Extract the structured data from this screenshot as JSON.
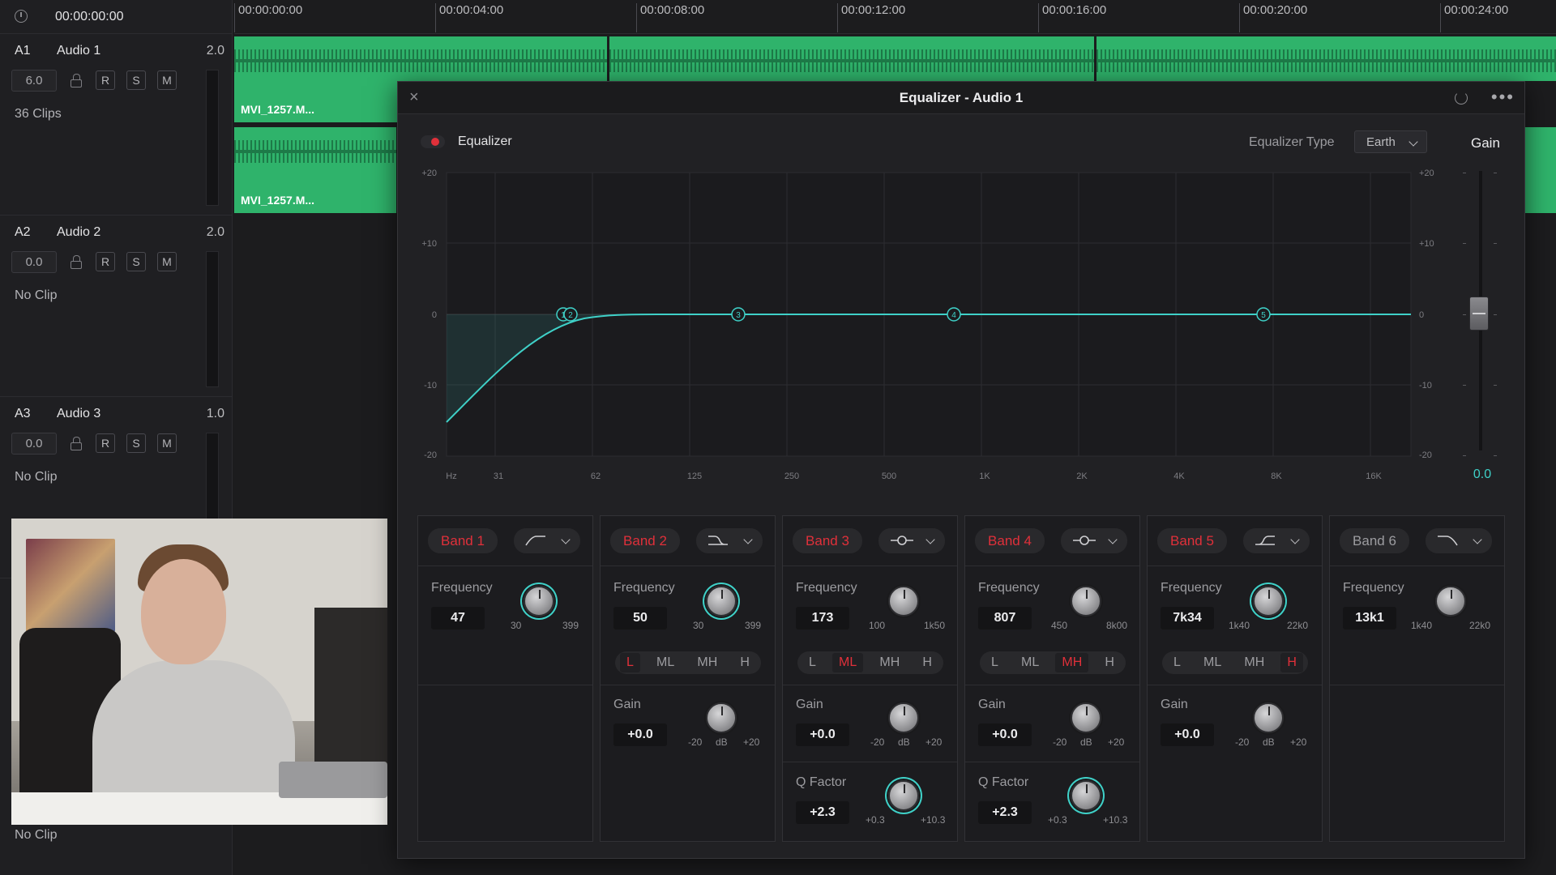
{
  "timecode": "00:00:00:00",
  "ruler": [
    "00:00:00:00",
    "00:00:04:00",
    "00:00:08:00",
    "00:00:12:00",
    "00:00:16:00",
    "00:00:20:00",
    "00:00:24:00"
  ],
  "tracks": [
    {
      "id": "A1",
      "name": "Audio 1",
      "channels": "2.0",
      "volume": "6.0",
      "info": "36 Clips"
    },
    {
      "id": "A2",
      "name": "Audio 2",
      "channels": "2.0",
      "volume": "0.0",
      "info": "No Clip"
    },
    {
      "id": "A3",
      "name": "Audio 3",
      "channels": "1.0",
      "volume": "0.0",
      "info": "No Clip"
    }
  ],
  "track_buttons": {
    "r": "R",
    "s": "S",
    "m": "M"
  },
  "bottom_info": "No Clip",
  "clip_label": "MVI_1257.M...",
  "clip_color": "#2fb36b",
  "window": {
    "title": "Equalizer - Audio 1",
    "close": "×",
    "more": "•••"
  },
  "equalizer": {
    "label": "Equalizer",
    "enabled": true,
    "type_label": "Equalizer Type",
    "type_value": "Earth",
    "gain_label": "Gain",
    "gain_value": "0.0",
    "accent_color": "#3fd1c8",
    "active_color": "#e0303a"
  },
  "graph": {
    "y_ticks": [
      "+20",
      "+10",
      "0",
      "-10",
      "-20"
    ],
    "x_ticks": [
      "Hz",
      "31",
      "62",
      "125",
      "250",
      "500",
      "1K",
      "2K",
      "4K",
      "8K",
      "16K"
    ],
    "nodes": [
      "1",
      "2",
      "3",
      "4",
      "5"
    ]
  },
  "bands": [
    {
      "name": "Band 1",
      "enabled": true,
      "shape": "high-pass-icon",
      "freq_label": "Frequency",
      "freq": "47",
      "freq_min": "30",
      "freq_max": "399"
    },
    {
      "name": "Band 2",
      "enabled": true,
      "shape": "low-shelf-icon",
      "freq_label": "Frequency",
      "freq": "50",
      "freq_min": "30",
      "freq_max": "399",
      "seg": [
        "L",
        "ML",
        "MH",
        "H"
      ],
      "seg_active": "L",
      "gain_label": "Gain",
      "gain": "+0.0",
      "gain_min": "-20",
      "gain_unit": "dB",
      "gain_max": "+20"
    },
    {
      "name": "Band 3",
      "enabled": true,
      "shape": "bell-icon",
      "freq_label": "Frequency",
      "freq": "173",
      "freq_min": "100",
      "freq_max": "1k50",
      "seg": [
        "L",
        "ML",
        "MH",
        "H"
      ],
      "seg_active": "ML",
      "gain_label": "Gain",
      "gain": "+0.0",
      "gain_min": "-20",
      "gain_unit": "dB",
      "gain_max": "+20",
      "q_label": "Q Factor",
      "q": "+2.3",
      "q_min": "+0.3",
      "q_max": "+10.3"
    },
    {
      "name": "Band 4",
      "enabled": true,
      "shape": "bell-icon",
      "freq_label": "Frequency",
      "freq": "807",
      "freq_min": "450",
      "freq_max": "8k00",
      "seg": [
        "L",
        "ML",
        "MH",
        "H"
      ],
      "seg_active": "MH",
      "gain_label": "Gain",
      "gain": "+0.0",
      "gain_min": "-20",
      "gain_unit": "dB",
      "gain_max": "+20",
      "q_label": "Q Factor",
      "q": "+2.3",
      "q_min": "+0.3",
      "q_max": "+10.3"
    },
    {
      "name": "Band 5",
      "enabled": true,
      "shape": "high-shelf-icon",
      "freq_label": "Frequency",
      "freq": "7k34",
      "freq_min": "1k40",
      "freq_max": "22k0",
      "seg": [
        "L",
        "ML",
        "MH",
        "H"
      ],
      "seg_active": "H",
      "gain_label": "Gain",
      "gain": "+0.0",
      "gain_min": "-20",
      "gain_unit": "dB",
      "gain_max": "+20"
    },
    {
      "name": "Band 6",
      "enabled": false,
      "shape": "low-pass-icon",
      "freq_label": "Frequency",
      "freq": "13k1",
      "freq_min": "1k40",
      "freq_max": "22k0"
    }
  ]
}
